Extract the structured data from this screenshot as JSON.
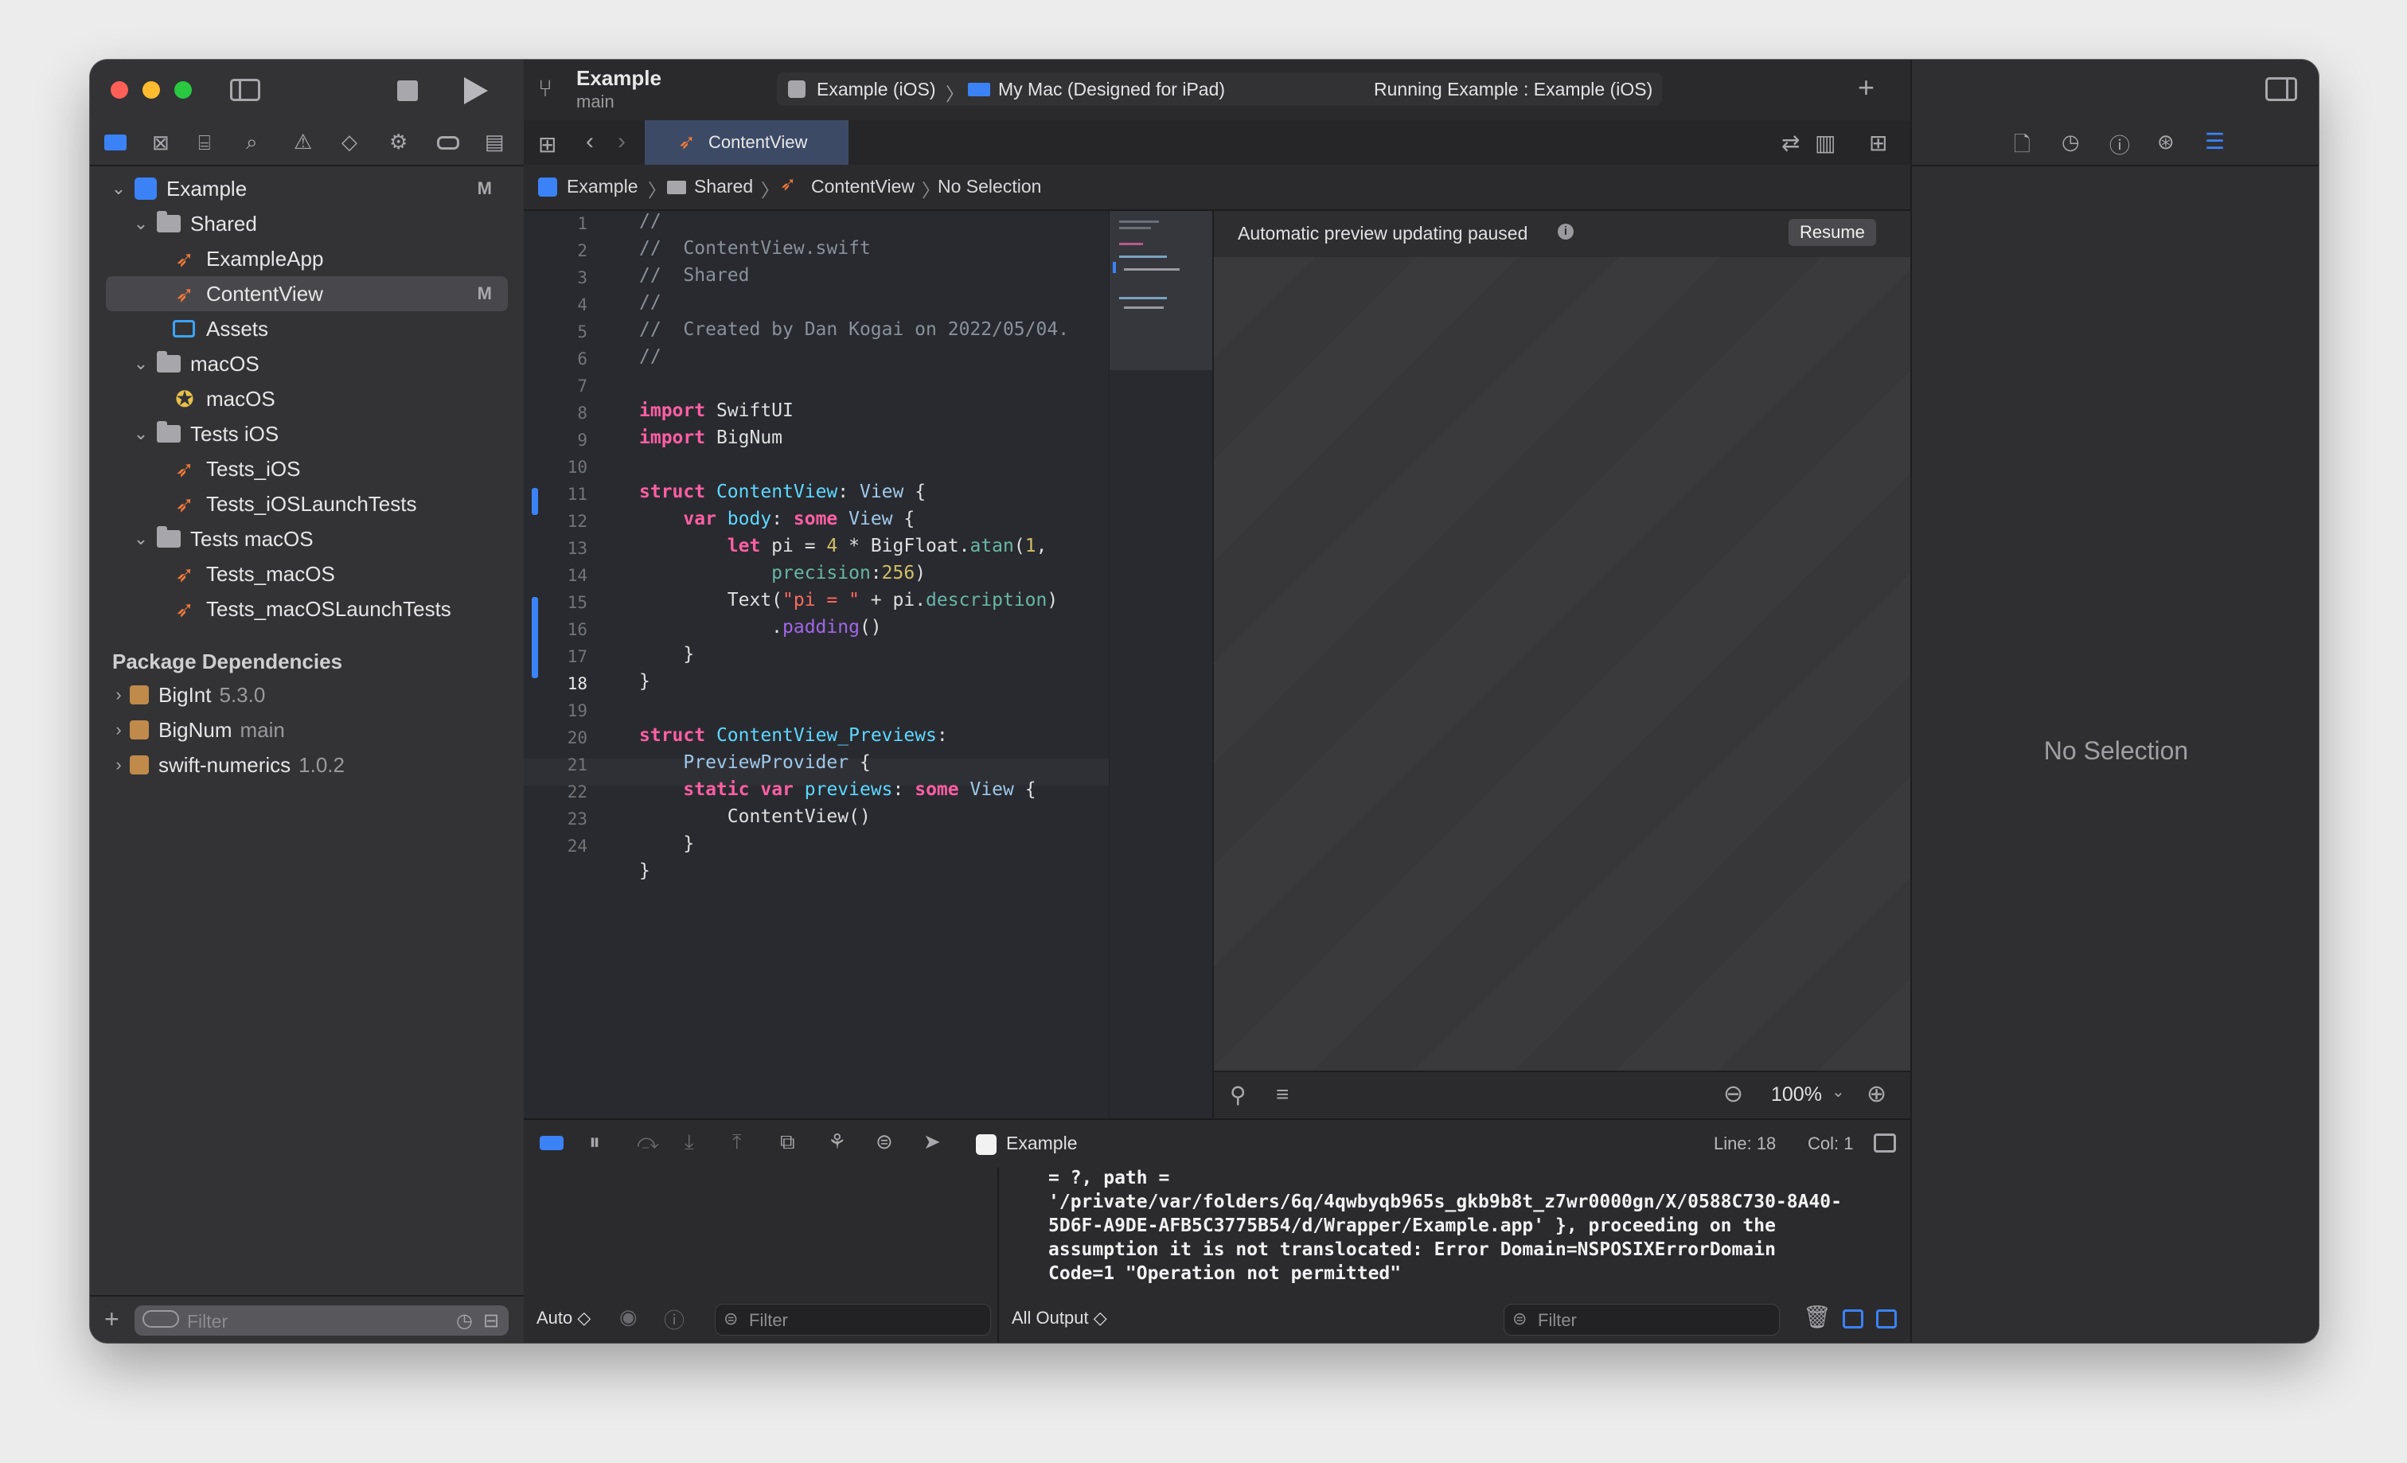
{
  "project": {
    "name": "Example",
    "branch": "main"
  },
  "toolbar": {
    "scheme": "Example (iOS)",
    "separator": "〉",
    "destination": "My Mac (Designed for iPad)",
    "status": "Running Example : Example (iOS)",
    "add_label": "+"
  },
  "navigator": {
    "tree": [
      {
        "label": "Example",
        "badge": "M",
        "kind": "project"
      },
      {
        "label": "Shared",
        "kind": "folder"
      },
      {
        "label": "ExampleApp",
        "kind": "swift"
      },
      {
        "label": "ContentView",
        "badge": "M",
        "kind": "swift",
        "selected": true
      },
      {
        "label": "Assets",
        "kind": "assets"
      },
      {
        "label": "macOS",
        "kind": "folder"
      },
      {
        "label": "macOS",
        "kind": "entitlements"
      },
      {
        "label": "Tests iOS",
        "kind": "folder"
      },
      {
        "label": "Tests_iOS",
        "kind": "swift"
      },
      {
        "label": "Tests_iOSLaunchTests",
        "kind": "swift"
      },
      {
        "label": "Tests macOS",
        "kind": "folder"
      },
      {
        "label": "Tests_macOS",
        "kind": "swift"
      },
      {
        "label": "Tests_macOSLaunchTests",
        "kind": "swift"
      }
    ],
    "packages_header": "Package Dependencies",
    "packages": [
      {
        "name": "BigInt",
        "version": "5.3.0"
      },
      {
        "name": "BigNum",
        "version": "main"
      },
      {
        "name": "swift-numerics",
        "version": "1.0.2"
      }
    ],
    "filter_placeholder": "Filter"
  },
  "tab": {
    "label": "ContentView"
  },
  "breadcrumb": {
    "project": "Example",
    "folder": "Shared",
    "file": "ContentView",
    "symbol": "No Selection"
  },
  "editor": {
    "line_numbers": [
      "1",
      "2",
      "3",
      "4",
      "5",
      "6",
      "7",
      "8",
      "9",
      "10",
      "11",
      "12",
      "13",
      "14",
      "15",
      "16",
      "17",
      "18",
      "19",
      "20",
      "21",
      "22",
      "23",
      "24"
    ],
    "current_line": "18"
  },
  "canvas": {
    "message": "Automatic preview updating paused",
    "resume_label": "Resume",
    "zoom": "100%"
  },
  "debug": {
    "process": "Example",
    "line_label": "Line: 18",
    "col_label": "Col: 1",
    "auto_label": "Auto ◇",
    "all_output_label": "All Output ◇",
    "filter_placeholder": "Filter",
    "console_lines": [
      "= ?, path =",
      "'/private/var/folders/6q/4qwbyqb965s_gkb9b8t_z7wr0000gn/X/0588C730-8A40-",
      "5D6F-A9DE-AFB5C3775B54/d/Wrapper/Example.app' }, proceeding on the",
      "assumption it is not translocated: Error Domain=NSPOSIXErrorDomain",
      "Code=1 \"Operation not permitted\""
    ]
  },
  "inspector": {
    "empty_label": "No Selection"
  },
  "colors": {
    "accent": "#3b82f6",
    "swift": "#f0793a",
    "keyword": "#fc5fa3",
    "comment": "#8a9199"
  }
}
